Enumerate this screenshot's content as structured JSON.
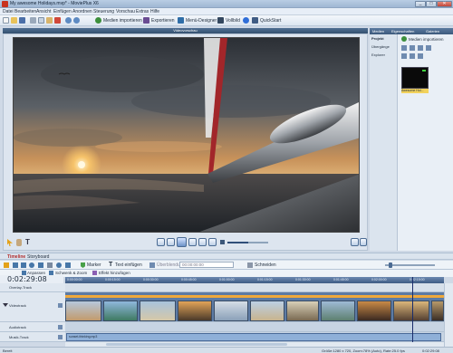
{
  "window": {
    "title": "My awesome Holidays.mvp* - MoviePlus X6",
    "minimize": "_",
    "maximize": "□",
    "close": "✕"
  },
  "menu": [
    "Datei",
    "Bearbeiten",
    "Ansicht",
    "Einfügen",
    "Anordnen",
    "Steuerung",
    "Vorschau",
    "Extras",
    "Hilfe"
  ],
  "toolbar": {
    "import_label": "Medien importieren",
    "export_label": "Exportieren",
    "menu_designer_label": "Menü-Designer",
    "fullscreen_label": "Vollbild",
    "quickstart_label": "QuickStart"
  },
  "preview": {
    "title": "Videovorschau",
    "volume_pct": 50
  },
  "right_panel": {
    "tabs": [
      "Medien",
      "Eigenschaften",
      "Galerien"
    ],
    "sidebar": [
      "Projekt",
      "Übergänge",
      "Explorer"
    ],
    "import_label": "Medien importieren",
    "thumb_label": "Awesome Hol..."
  },
  "timeline": {
    "tabs": [
      "Timeline",
      "Storyboard"
    ],
    "tools": {
      "marker_label": "Marker",
      "insert_text_label": "Text einfügen",
      "transition_label": "Überblendung",
      "transition_time": "00:00:00:00",
      "cut_label": "Schneiden"
    },
    "tools2": {
      "adjust_label": "Anpassen",
      "pan_zoom_label": "Schwenk & Zoom",
      "add_effect_label": "Effekt hinzufügen"
    },
    "timecode": "0:02:29:08",
    "ruler": [
      "0:00:00:00",
      "0:00:15:00",
      "0:00:30:00",
      "0:00:45:00",
      "0:01:00:00",
      "0:01:15:00",
      "0:01:30:00",
      "0:01:45:00",
      "0:02:00:00",
      "0:02:15:00"
    ],
    "tracks": {
      "overlay": "Overlay-Track",
      "video": "Videotrack",
      "audio": "Audiotrack",
      "music": "Musik-Track"
    },
    "music_clip_label": "sunset-thinking.mp3"
  },
  "status": {
    "left": "Bereit",
    "info": "Größe:1280 x 720, Zoom:78% (Auto), Rate:25.0 fps",
    "time": "0:02:29:08"
  },
  "colors": {
    "accent": "#3f5c84",
    "ruler_bg": "#4d6b95",
    "panel_bg": "#e9eff6"
  }
}
